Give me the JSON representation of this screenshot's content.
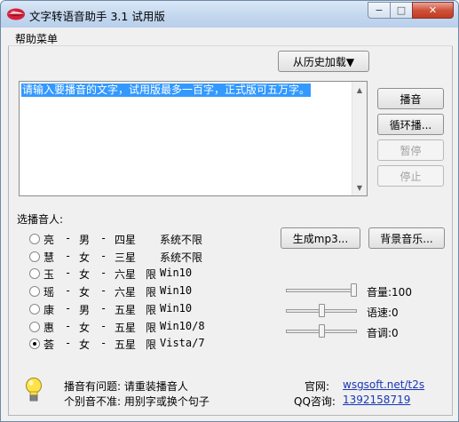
{
  "window": {
    "title": "文字转语音助手 3.1 试用版"
  },
  "titlebar_buttons": {
    "minimize": "−",
    "maximize": "□",
    "close": "✕"
  },
  "menu": {
    "help": "帮助菜单"
  },
  "history_button": "从历史加载▼",
  "editor": {
    "text": "请输入要播音的文字，试用版最多一百字，正式版可五万字。"
  },
  "controls": {
    "play": "播音",
    "loop": "循环播...",
    "pause": "暂停",
    "stop": "停止"
  },
  "speaker_section": {
    "title": "选播音人:"
  },
  "speakers": [
    {
      "name": "亮",
      "gender": "男",
      "stars": "四星",
      "limit": "",
      "system": "系统不限",
      "selected": false
    },
    {
      "name": "慧",
      "gender": "女",
      "stars": "三星",
      "limit": "",
      "system": "系统不限",
      "selected": false
    },
    {
      "name": "玉",
      "gender": "女",
      "stars": "六星",
      "limit": "限",
      "system": "Win10",
      "selected": false
    },
    {
      "name": "瑶",
      "gender": "女",
      "stars": "六星",
      "limit": "限",
      "system": "Win10",
      "selected": false
    },
    {
      "name": "康",
      "gender": "男",
      "stars": "五星",
      "limit": "限",
      "system": "Win10",
      "selected": false
    },
    {
      "name": "惠",
      "gender": "女",
      "stars": "五星",
      "limit": "限",
      "system": "Win10/8",
      "selected": false
    },
    {
      "name": "荟",
      "gender": "女",
      "stars": "五星",
      "limit": "限",
      "system": "Vista/7",
      "selected": true
    }
  ],
  "separator": "-",
  "output": {
    "mp3": "生成mp3...",
    "bgm": "背景音乐..."
  },
  "volume": {
    "label": "音量:100",
    "value": 100,
    "max": 100
  },
  "speed": {
    "label": "语速:0",
    "value": 0,
    "min": -10,
    "max": 10
  },
  "pitch": {
    "label": "音调:0",
    "value": 0,
    "min": -10,
    "max": 10
  },
  "tips": {
    "line1": "播音有问题: 请重装播音人",
    "line2": "个别音不准: 用别字或换个句子"
  },
  "contact": {
    "site_label": "官网:",
    "site": "wsgsoft.net/t2s",
    "qq_label": "QQ咨询:",
    "qq": "1392158719"
  },
  "colors": {
    "selection": "#3399ff",
    "link": "#1a36b8",
    "face": "#f0f0f0"
  }
}
